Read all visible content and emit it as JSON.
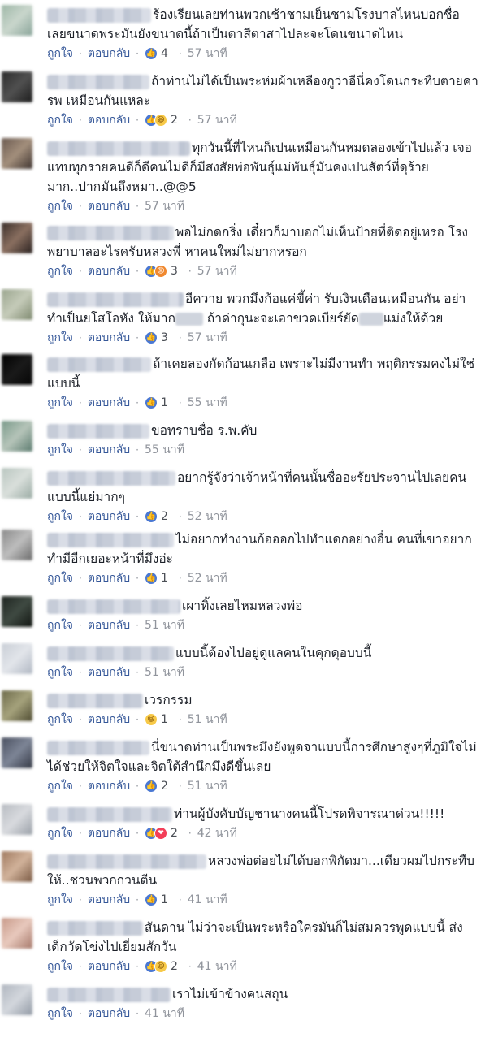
{
  "actions": {
    "like": "ถูกใจ",
    "reply": "ตอบกลับ",
    "separator": "·"
  },
  "comments": [
    {
      "text": "ร้องเรียนเลยท่านพวกเช้าชามเย็นชามโรงบาลไหนบอกชื่อเลยขนาดพระมันยังขนาดนี้ถ้าเป็นตาสีตาสาไปละจะโดนขนาดไหน",
      "reactions": [
        "like"
      ],
      "count": "4",
      "time": "57 นาที"
    },
    {
      "text": "ถ้าท่านไม่ได้เป็นพระห่มผ้าเหลืองกูว่าอีนี่คงโดนกระทืบตายคา รพ เหมือนกันแหละ",
      "reactions": [
        "like",
        "haha"
      ],
      "count": "2",
      "time": "57 นาที"
    },
    {
      "text": "ทุกวันนี้ที่ไหนก็เปนเหมือนกันหมดลองเข้าไปแล้ว เจอแทบทุกรายคนดีก็ดีคนไม่ดีก็มีสงสัยพ่อพันธุ์แม่พันธุ์มันคงเปนสัตว์ที่ดุร้ายมาก..ปากมันถึงหมา..@@5",
      "reactions": [],
      "count": "",
      "time": "57 นาที"
    },
    {
      "text": "พอไม่กดกริ่ง เดี๋ยวก็มาบอกไม่เห็นป้ายที่ติดอยู่เหรอ โรงพยาบาลอะไรครับหลวงพี่ หาคนใหม่ไม่ยากหรอก",
      "reactions": [
        "like",
        "angry"
      ],
      "count": "3",
      "time": "57 นาที"
    },
    {
      "text_a": "อีควาย พวกมึงก้อแค่ขี้ค่า รับเงินเดือนเหมือนกัน อย่าทำเป็นยโสโอหัง ให้มาก",
      "text_b": "ถ้าด่ากุนะจะเอาขวดเบียร์ยัด",
      "text_c": "แม่งให้ด้วย",
      "reactions": [
        "like"
      ],
      "count": "3",
      "time": "57 นาที"
    },
    {
      "text": "ถ้าเคยลองกัดก้อนเกลือ เพราะไม่มีงานทำ พฤติกรรมคงไม่ใช่แบบนี้",
      "reactions": [
        "like"
      ],
      "count": "1",
      "time": "55 นาที"
    },
    {
      "text": "ขอทราบชื่อ ร.พ.คับ",
      "reactions": [],
      "count": "",
      "time": "55 นาที"
    },
    {
      "text": "อยากรู้จังว่าเจ้าหน้าที่คนนั้นชื่ออะรัยประจานไปเลยคนแบบนี้แย่มากๆ",
      "reactions": [
        "like"
      ],
      "count": "2",
      "time": "52 นาที"
    },
    {
      "text": "ไม่อยากทำงานก้อออกไปทำแดกอย่างอื่น คนที่เขาอยากทำมีอีกเยอะหน้าที่มึงอ่ะ",
      "reactions": [
        "like"
      ],
      "count": "1",
      "time": "52 นาที"
    },
    {
      "text": "เผาทิ้งเลยไหมหลวงพ่อ",
      "reactions": [],
      "count": "",
      "time": "51 นาที"
    },
    {
      "text": "แบบนี้ต้องไปอยู่ดูแลคนในคุกดุอบบนี้",
      "reactions": [],
      "count": "",
      "time": "51 นาที"
    },
    {
      "text": "เวรกรรม",
      "reactions": [
        "haha"
      ],
      "count": "1",
      "time": "51 นาที"
    },
    {
      "text": "นี่ขนาดท่านเป็นพระมึงยังพูดจาแบบนี้การศึกษาสูงๆที่ภูมิใจไม่ได้ช่วยให้จิตใจและจิตใต้สำนึกมึงดีขึ้นเลย",
      "reactions": [
        "like"
      ],
      "count": "2",
      "time": "51 นาที"
    },
    {
      "text": "ท่านผู้บังคับบัญชานางคนนี้โปรดพิจารณาด่วน!!!!!",
      "reactions": [
        "like",
        "love"
      ],
      "count": "2",
      "time": "42 นาที"
    },
    {
      "text": "หลวงพ่อต่อยไม่ได้บอกพิกัดมา...เดียวผมไปกระทืบให้..ชวนพวกกวนตีน",
      "reactions": [
        "like"
      ],
      "count": "1",
      "time": "41 นาที"
    },
    {
      "text": "สันดาน ไม่ว่าจะเป็นพระหรือใครมันก็ไม่สมควรพูดแบบนี้ ส่งเด็กวัดโข่งไปเยี่ยมสักวัน",
      "reactions": [
        "like",
        "haha"
      ],
      "count": "2",
      "time": "41 นาที"
    },
    {
      "text": "เราไม่เข้าข้างคนสถุน",
      "reactions": [],
      "count": "",
      "time": "41 นาที"
    }
  ],
  "colors": {
    "link": "#365899",
    "muted": "#90949c",
    "like": "#4a78d3"
  },
  "icons": {
    "like": "thumbs-up-icon",
    "haha": "haha-icon",
    "angry": "angry-icon",
    "love": "heart-icon"
  }
}
